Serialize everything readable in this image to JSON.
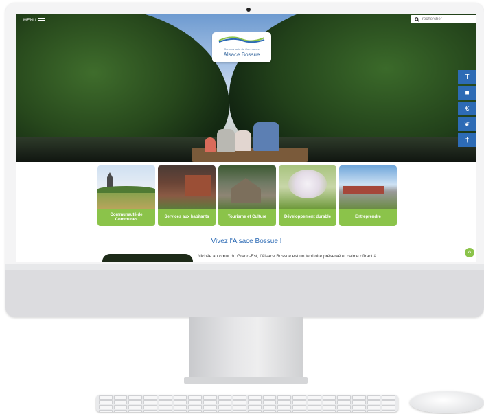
{
  "site": {
    "menu_label": "MENU",
    "search_placeholder": "rechercher",
    "logo": {
      "subtitle": "Communauté de Communes",
      "name": "Alsace Bossue"
    },
    "side_tools": [
      {
        "icon": "signpost-icon",
        "glyph": "T"
      },
      {
        "icon": "book-icon",
        "glyph": "■"
      },
      {
        "icon": "euro-icon",
        "glyph": "€"
      },
      {
        "icon": "leaf-icon",
        "glyph": "❦"
      },
      {
        "icon": "person-icon",
        "glyph": "†"
      }
    ],
    "tiles": [
      {
        "label": "Communauté de Communes"
      },
      {
        "label": "Services aux habitants"
      },
      {
        "label": "Tourisme et Culture"
      },
      {
        "label": "Développement durable"
      },
      {
        "label": "Entreprendre"
      }
    ],
    "tagline": "Vivez l'Alsace Bossue !",
    "intro_text": "Nichée au cœur du Grand-Est, l'Alsace Bossue est un territoire préservé et calme offrant à",
    "back_to_top_glyph": "^"
  },
  "colors": {
    "accent_green": "#8bc34a",
    "accent_blue": "#2d6bb5"
  }
}
